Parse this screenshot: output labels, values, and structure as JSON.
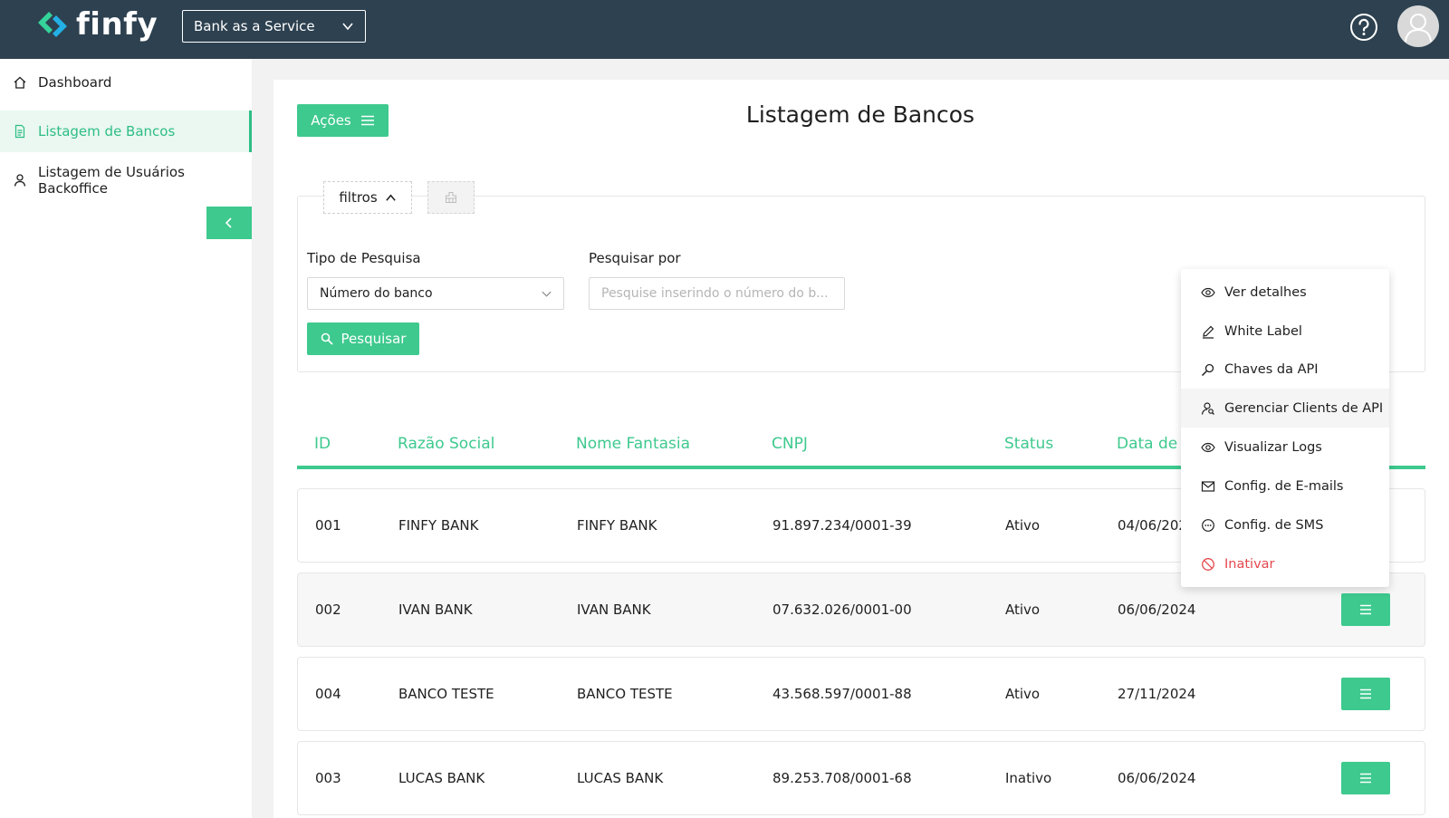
{
  "header": {
    "logo_text": "finfy",
    "service_select": "Bank as a Service",
    "help_icon": "help-circle-icon",
    "avatar_icon": "user-avatar-icon"
  },
  "sidebar": {
    "items": [
      {
        "label": "Dashboard",
        "icon": "home-icon"
      },
      {
        "label": "Listagem de Bancos",
        "icon": "document-icon",
        "active": true
      },
      {
        "label": "Listagem de Usuários Backoffice",
        "icon": "user-icon"
      }
    ],
    "collapse_icon": "chevron-left-icon"
  },
  "toolbar": {
    "acoes_label": "Ações"
  },
  "page": {
    "title": "Listagem de Bancos"
  },
  "filters": {
    "tab_label": "filtros",
    "tipo_label": "Tipo de Pesquisa",
    "tipo_value": "Número do banco",
    "pesquisar_por_label": "Pesquisar por",
    "search_placeholder": "Pesquise inserindo o número do b...",
    "search_button": "Pesquisar"
  },
  "table": {
    "headers": [
      "ID",
      "Razão Social",
      "Nome Fantasia",
      "CNPJ",
      "Status",
      "Data de C"
    ],
    "rows": [
      {
        "id": "001",
        "razao": "FINFY BANK",
        "fantasia": "FINFY BANK",
        "cnpj": "91.897.234/0001-39",
        "status": "Ativo",
        "data": "04/06/202"
      },
      {
        "id": "002",
        "razao": "IVAN BANK",
        "fantasia": "IVAN BANK",
        "cnpj": "07.632.026/0001-00",
        "status": "Ativo",
        "data": "06/06/2024"
      },
      {
        "id": "004",
        "razao": "BANCO TESTE",
        "fantasia": "BANCO TESTE",
        "cnpj": "43.568.597/0001-88",
        "status": "Ativo",
        "data": "27/11/2024"
      },
      {
        "id": "003",
        "razao": "LUCAS BANK",
        "fantasia": "LUCAS BANK",
        "cnpj": "89.253.708/0001-68",
        "status": "Inativo",
        "data": "06/06/2024"
      }
    ]
  },
  "dropdown": {
    "items": [
      {
        "label": "Ver detalhes",
        "icon": "eye-icon"
      },
      {
        "label": "White Label",
        "icon": "pencil-icon"
      },
      {
        "label": "Chaves da API",
        "icon": "key-search-icon"
      },
      {
        "label": "Gerenciar Clients de API",
        "icon": "user-search-icon"
      },
      {
        "label": "Visualizar Logs",
        "icon": "eye-icon"
      },
      {
        "label": "Config. de E-mails",
        "icon": "mail-icon"
      },
      {
        "label": "Config. de SMS",
        "icon": "message-icon"
      },
      {
        "label": "Inativar",
        "icon": "block-icon"
      }
    ]
  },
  "colors": {
    "header_bg": "#2d4150",
    "accent": "#3ec98e",
    "danger": "#e5484d"
  }
}
